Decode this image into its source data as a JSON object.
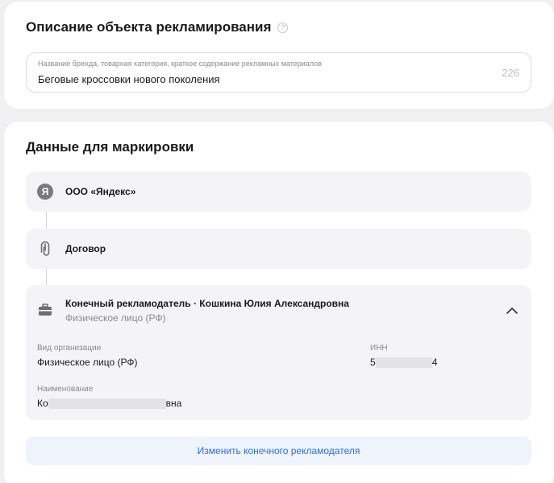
{
  "description": {
    "title": "Описание объекта рекламирования",
    "help_icon": "?",
    "field_label": "Название бренда, товарная категория, краткое содержание рекламных материалов",
    "field_value": "Беговые кроссовки нового поколения",
    "char_count": "226"
  },
  "marking": {
    "title": "Данные для маркировки",
    "org": {
      "icon": "Я",
      "label": "ООО «Яндекс»"
    },
    "contract": {
      "label": "Договор"
    },
    "advertiser": {
      "title": "Конечный рекламодатель · Кошкина Юлия Александровна",
      "subtitle": "Физическое лицо (РФ)",
      "org_type_label": "Вид организации",
      "org_type_value": "Физическое лицо (РФ)",
      "inn_label": "ИНН",
      "inn_start": "5",
      "inn_end": "4",
      "name_label": "Наименование",
      "name_start": "Ко",
      "name_end": "вна"
    },
    "change_button": "Изменить конечного рекламодателя"
  },
  "colors": {
    "accent": "#2f6fe0",
    "button_bg": "#eef3fc",
    "block_bg": "#f4f4f6"
  },
  "icons": [
    "help-icon",
    "yandex-logo-icon",
    "paperclip-icon",
    "briefcase-icon",
    "chevron-up-icon"
  ]
}
